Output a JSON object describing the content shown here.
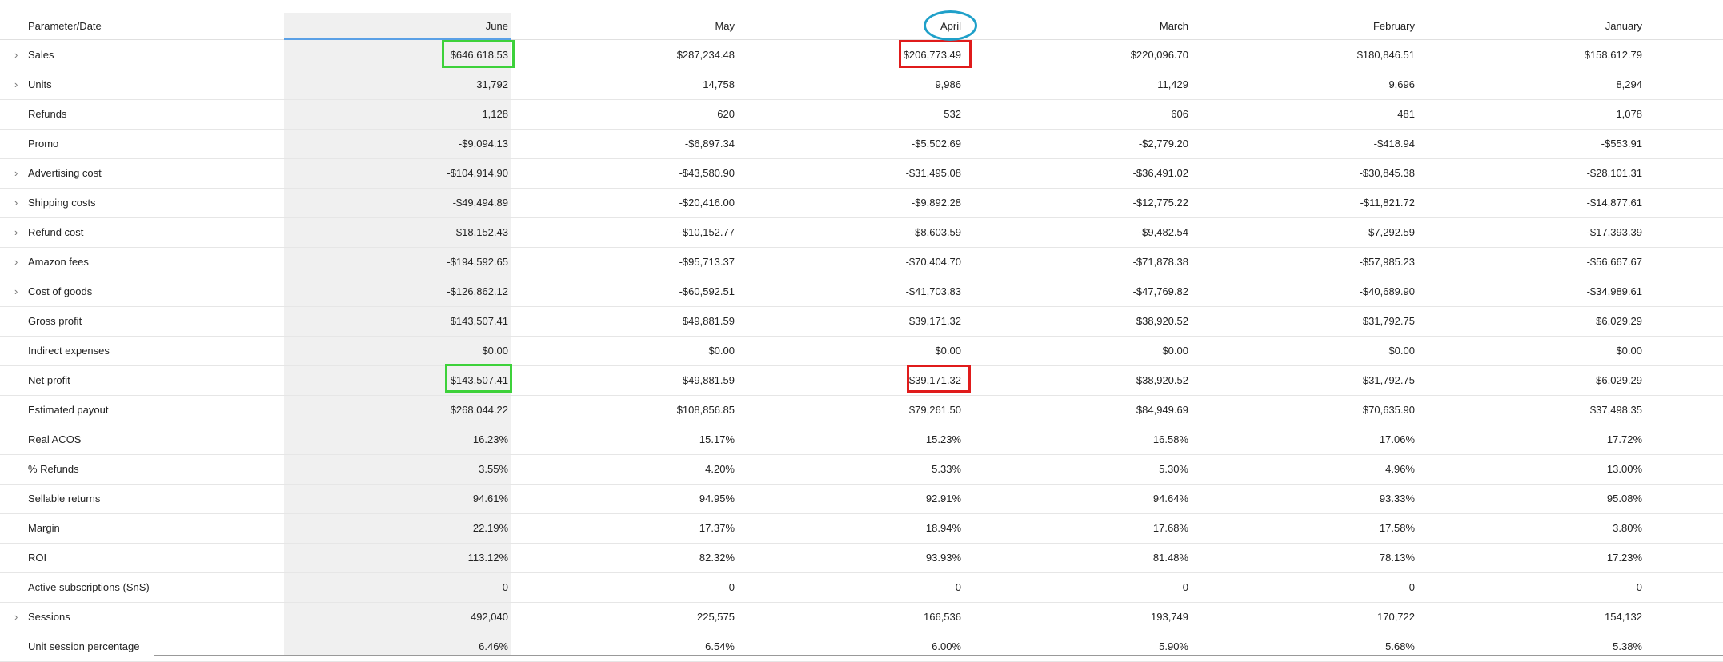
{
  "header": {
    "param_label": "Parameter/Date",
    "months": [
      "June",
      "May",
      "April",
      "March",
      "February",
      "January"
    ]
  },
  "rows": [
    {
      "label": "Sales",
      "expandable": true,
      "values": [
        "$646,618.53",
        "$287,234.48",
        "$206,773.49",
        "$220,096.70",
        "$180,846.51",
        "$158,612.79"
      ]
    },
    {
      "label": "Units",
      "expandable": true,
      "values": [
        "31,792",
        "14,758",
        "9,986",
        "11,429",
        "9,696",
        "8,294"
      ]
    },
    {
      "label": "Refunds",
      "expandable": false,
      "values": [
        "1,128",
        "620",
        "532",
        "606",
        "481",
        "1,078"
      ]
    },
    {
      "label": "Promo",
      "expandable": false,
      "values": [
        "-$9,094.13",
        "-$6,897.34",
        "-$5,502.69",
        "-$2,779.20",
        "-$418.94",
        "-$553.91"
      ]
    },
    {
      "label": "Advertising cost",
      "expandable": true,
      "values": [
        "-$104,914.90",
        "-$43,580.90",
        "-$31,495.08",
        "-$36,491.02",
        "-$30,845.38",
        "-$28,101.31"
      ]
    },
    {
      "label": "Shipping costs",
      "expandable": true,
      "values": [
        "-$49,494.89",
        "-$20,416.00",
        "-$9,892.28",
        "-$12,775.22",
        "-$11,821.72",
        "-$14,877.61"
      ]
    },
    {
      "label": "Refund cost",
      "expandable": true,
      "values": [
        "-$18,152.43",
        "-$10,152.77",
        "-$8,603.59",
        "-$9,482.54",
        "-$7,292.59",
        "-$17,393.39"
      ]
    },
    {
      "label": "Amazon fees",
      "expandable": true,
      "values": [
        "-$194,592.65",
        "-$95,713.37",
        "-$70,404.70",
        "-$71,878.38",
        "-$57,985.23",
        "-$56,667.67"
      ]
    },
    {
      "label": "Cost of goods",
      "expandable": true,
      "values": [
        "-$126,862.12",
        "-$60,592.51",
        "-$41,703.83",
        "-$47,769.82",
        "-$40,689.90",
        "-$34,989.61"
      ]
    },
    {
      "label": "Gross profit",
      "expandable": false,
      "values": [
        "$143,507.41",
        "$49,881.59",
        "$39,171.32",
        "$38,920.52",
        "$31,792.75",
        "$6,029.29"
      ]
    },
    {
      "label": "Indirect expenses",
      "expandable": false,
      "values": [
        "$0.00",
        "$0.00",
        "$0.00",
        "$0.00",
        "$0.00",
        "$0.00"
      ]
    },
    {
      "label": "Net profit",
      "expandable": false,
      "values": [
        "$143,507.41",
        "$49,881.59",
        "$39,171.32",
        "$38,920.52",
        "$31,792.75",
        "$6,029.29"
      ]
    },
    {
      "label": "Estimated payout",
      "expandable": false,
      "values": [
        "$268,044.22",
        "$108,856.85",
        "$79,261.50",
        "$84,949.69",
        "$70,635.90",
        "$37,498.35"
      ]
    },
    {
      "label": "Real ACOS",
      "expandable": false,
      "values": [
        "16.23%",
        "15.17%",
        "15.23%",
        "16.58%",
        "17.06%",
        "17.72%"
      ]
    },
    {
      "label": "% Refunds",
      "expandable": false,
      "values": [
        "3.55%",
        "4.20%",
        "5.33%",
        "5.30%",
        "4.96%",
        "13.00%"
      ]
    },
    {
      "label": "Sellable returns",
      "expandable": false,
      "values": [
        "94.61%",
        "94.95%",
        "92.91%",
        "94.64%",
        "93.33%",
        "95.08%"
      ]
    },
    {
      "label": "Margin",
      "expandable": false,
      "values": [
        "22.19%",
        "17.37%",
        "18.94%",
        "17.68%",
        "17.58%",
        "3.80%"
      ]
    },
    {
      "label": "ROI",
      "expandable": false,
      "values": [
        "113.12%",
        "82.32%",
        "93.93%",
        "81.48%",
        "78.13%",
        "17.23%"
      ]
    },
    {
      "label": "Active subscriptions (SnS)",
      "expandable": false,
      "values": [
        "0",
        "0",
        "0",
        "0",
        "0",
        "0"
      ]
    },
    {
      "label": "Sessions",
      "expandable": true,
      "values": [
        "492,040",
        "225,575",
        "166,536",
        "193,749",
        "170,722",
        "154,132"
      ]
    },
    {
      "label": "Unit session percentage",
      "expandable": false,
      "values": [
        "6.46%",
        "6.54%",
        "6.00%",
        "5.90%",
        "5.68%",
        "5.38%"
      ]
    }
  ],
  "annotations": {
    "green_color": "#3dd13a",
    "red_color": "#e01b1b",
    "circle_color": "#1fa0c9"
  }
}
